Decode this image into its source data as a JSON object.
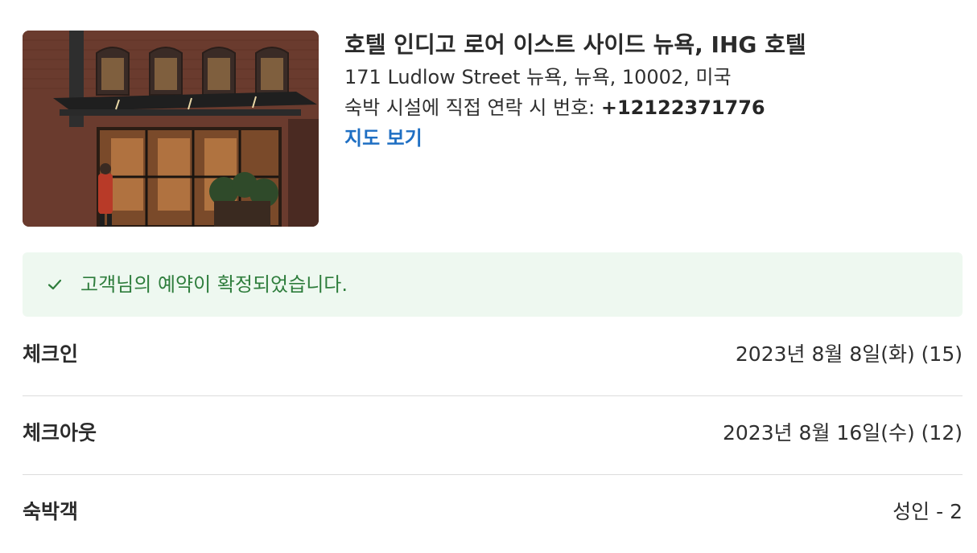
{
  "hotel": {
    "photo_alt": "hotel-storefront-photo",
    "name": "호텔 인디고 로어 이스트 사이드 뉴욕, IHG 호텔",
    "address": "171 Ludlow Street 뉴욕, 뉴욕, 10002, 미국",
    "phone_label": "숙박 시설에 직접 연락 시 번호: ",
    "phone_number": "+12122371776",
    "map_link": "지도 보기"
  },
  "confirmation": {
    "icon": "check-icon",
    "message": "고객님의 예약이 확정되었습니다.",
    "color": "#2e7d3c",
    "background": "#eef8f0"
  },
  "details": [
    {
      "label": "체크인",
      "value": "2023년 8월 8일(화) (15)"
    },
    {
      "label": "체크아웃",
      "value": "2023년 8월 16일(수) (12)"
    },
    {
      "label": "숙박객",
      "value": "성인 - 2"
    }
  ],
  "colors": {
    "link": "#1f6fc3",
    "text": "#2b2b2b",
    "divider": "#dcdcdc"
  }
}
